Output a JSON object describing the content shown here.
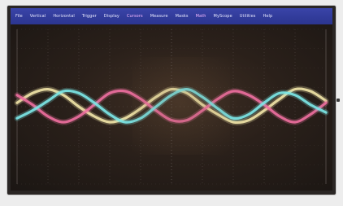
{
  "menu": {
    "items": [
      "File",
      "Vertical",
      "Horizontal",
      "Trigger",
      "Display",
      "Cursors",
      "Measure",
      "Masks",
      "Math",
      "MyScope",
      "Utilities",
      "Help"
    ]
  },
  "colors": {
    "menubar": "#2f3a9a",
    "trace_cyan": "#7ce8e8",
    "trace_magenta": "#ee6fa0",
    "trace_yellow": "#f2e6a8",
    "grid": "#6c6360"
  },
  "chart_data": {
    "type": "line",
    "xlim": [
      0,
      10
    ],
    "ylim": [
      -4,
      4
    ],
    "grid": true,
    "series": [
      {
        "color": "#f2e6a8",
        "x": [
          0,
          0.5,
          1,
          1.5,
          2,
          2.5,
          3,
          3.5,
          4,
          4.5,
          5,
          5.5,
          6,
          6.5,
          7,
          7.5,
          8,
          8.5,
          9,
          9.5,
          10
        ],
        "values": [
          0.2,
          0.7,
          0.9,
          0.6,
          0.0,
          -0.5,
          -0.8,
          -0.6,
          -0.1,
          0.5,
          0.9,
          0.7,
          0.1,
          -0.4,
          -0.8,
          -0.7,
          -0.2,
          0.4,
          0.9,
          0.8,
          0.3
        ]
      },
      {
        "color": "#ee6fa0",
        "x": [
          0,
          0.5,
          1,
          1.5,
          2,
          2.5,
          3,
          3.5,
          4,
          4.5,
          5,
          5.5,
          6,
          6.5,
          7,
          7.5,
          8,
          8.5,
          9,
          9.5,
          10
        ],
        "values": [
          0.6,
          0.1,
          -0.5,
          -0.8,
          -0.5,
          0.1,
          0.7,
          0.8,
          0.4,
          -0.2,
          -0.7,
          -0.7,
          -0.2,
          0.4,
          0.8,
          0.6,
          0.1,
          -0.5,
          -0.8,
          -0.4,
          0.2
        ]
      },
      {
        "color": "#7ce8e8",
        "x": [
          0,
          0.5,
          1,
          1.5,
          2,
          2.5,
          3,
          3.5,
          4,
          4.5,
          5,
          5.5,
          6,
          6.5,
          7,
          7.5,
          8,
          8.5,
          9,
          9.5,
          10
        ],
        "values": [
          -0.6,
          -0.2,
          0.3,
          0.8,
          0.7,
          0.2,
          -0.4,
          -0.8,
          -0.6,
          0.0,
          0.6,
          0.9,
          0.5,
          -0.1,
          -0.6,
          -0.4,
          0.2,
          0.7,
          0.6,
          0.1,
          -0.3
        ]
      }
    ]
  }
}
